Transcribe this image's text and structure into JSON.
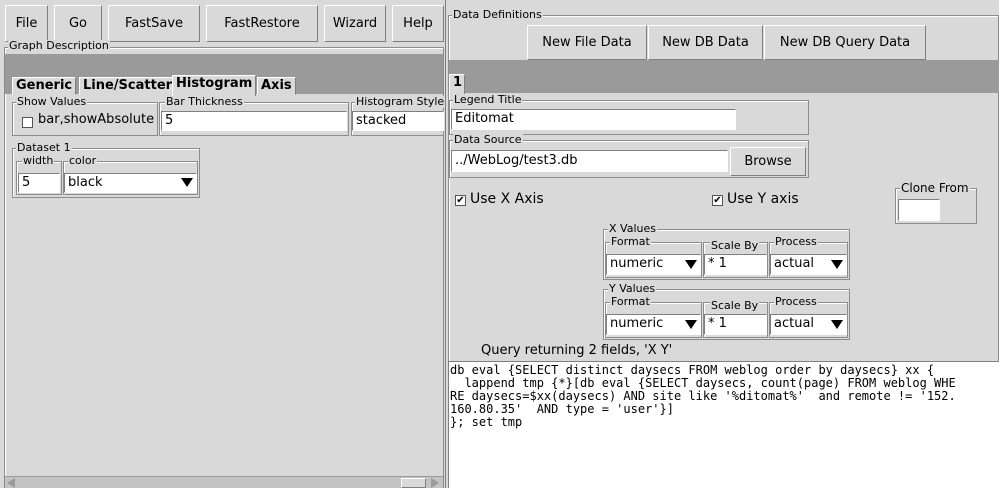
{
  "menu": {
    "file": "File",
    "go": "Go",
    "fastsave": "FastSave",
    "fastrestore": "FastRestore",
    "wizard": "Wizard",
    "help": "Help"
  },
  "graph": {
    "title": "Graph Description",
    "tabs": [
      "Generic",
      "Line/Scatter",
      "Histogram",
      "Axis"
    ],
    "show_values": {
      "label": "Show Values",
      "checkbox_label": "bar,showAbsolute",
      "checked": false
    },
    "bar_thickness": {
      "label": "Bar Thickness",
      "value": "5"
    },
    "histogram_style": {
      "label": "Histogram Style",
      "value": "stacked"
    },
    "dataset": {
      "label": "Dataset 1",
      "width_label": "width",
      "width_value": "5",
      "color_label": "color",
      "color_value": "black"
    }
  },
  "data_defs": {
    "title": "Data Definitions",
    "buttons": {
      "new_file": "New File Data",
      "new_db": "New DB Data",
      "new_db_query": "New DB Query Data"
    },
    "tab": "1",
    "legend_title": {
      "label": "Legend Title",
      "value": "Editomat"
    },
    "data_source": {
      "label": "Data Source",
      "value": "../WebLog/test3.db",
      "browse": "Browse"
    },
    "use_x": {
      "label": "Use X Axis",
      "checked": true
    },
    "use_y": {
      "label": "Use Y axis",
      "checked": true
    },
    "clone_from": {
      "label": "Clone From",
      "value": ""
    },
    "x_values": {
      "label": "X Values",
      "format_label": "Format",
      "format": "numeric",
      "scale_label": "Scale By",
      "scale": "* 1",
      "process_label": "Process",
      "process": "actual"
    },
    "y_values": {
      "label": "Y Values",
      "format_label": "Format",
      "format": "numeric",
      "scale_label": "Scale By",
      "scale": "* 1",
      "process_label": "Process",
      "process": "actual"
    },
    "query_status": "Query returning 2 fields, 'X Y'",
    "query_lines": [
      "db eval {SELECT distinct daysecs FROM weblog order by daysecs} xx {",
      "  lappend tmp {*}[db eval {SELECT daysecs, count(page) FROM weblog WHE",
      "RE daysecs=$xx(daysecs) AND site like '%ditomat%'  and remote != '152.",
      "160.80.35'  AND type = 'user'}]",
      "}; set tmp"
    ]
  }
}
